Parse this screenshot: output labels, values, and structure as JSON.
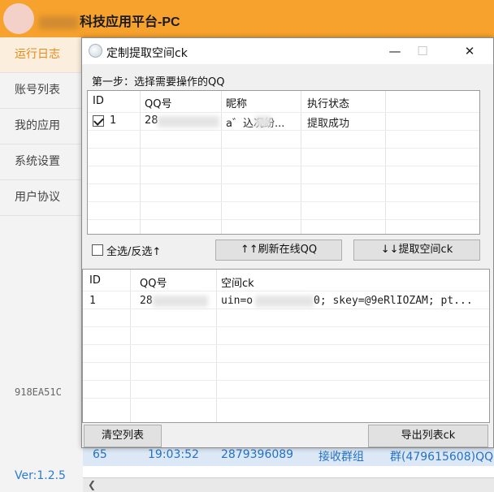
{
  "app": {
    "title": "科技应用平台-PC",
    "version": "Ver:1.2.5",
    "code": "918EA51C"
  },
  "sidebar": {
    "items": [
      {
        "label": "运行日志",
        "active": true
      },
      {
        "label": "账号列表",
        "active": false
      },
      {
        "label": "我的应用",
        "active": false
      },
      {
        "label": "系统设置",
        "active": false
      },
      {
        "label": "用户协议",
        "active": false
      }
    ]
  },
  "background_log_row": {
    "id": "65",
    "time": "19:03:52",
    "qq": "2879396089",
    "action": "接收群组",
    "target": "群(479615608)QQ"
  },
  "dialog": {
    "title": "定制提取空间ck",
    "minimize": "—",
    "maximize": "☐",
    "close": "✕",
    "step_label": "第一步：选择需要操作的QQ",
    "top_table": {
      "headers": [
        "ID",
        "QQ号",
        "昵称",
        "执行状态"
      ],
      "rows": [
        {
          "checked": true,
          "id": "1",
          "qq": "28",
          "nick": "a゛込况纷...",
          "status": "提取成功"
        }
      ]
    },
    "select_all_label": "全选/反选↑",
    "refresh_button": "↑↑刷新在线QQ",
    "extract_button": "↓↓提取空间ck",
    "bottom_table": {
      "headers": [
        "ID",
        "QQ号",
        "空间ck"
      ],
      "rows": [
        {
          "id": "1",
          "qq": "28",
          "ck_prefix": "uin=o",
          "ck_suffix": "0; skey=@9eRlIOZAM; pt..."
        }
      ]
    },
    "clear_button": "清空列表",
    "export_button": "导出列表ck"
  },
  "colors": {
    "header_orange": "#f7a22d",
    "accent_orange": "#e68a1a",
    "link_blue": "#2472c8"
  }
}
